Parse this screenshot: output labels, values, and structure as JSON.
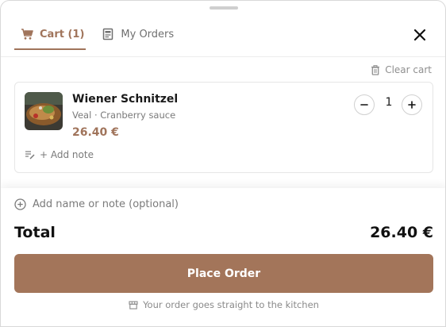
{
  "tabs": [
    {
      "label": "Cart (1)",
      "icon": "cart-icon",
      "active": true
    },
    {
      "label": "My Orders",
      "icon": "receipt-icon",
      "active": false
    }
  ],
  "close_icon": "close-icon",
  "clear_cart_label": "Clear cart",
  "cart_items": [
    {
      "name": "Wiener Schnitzel",
      "description": "Veal · Cranberry sauce",
      "price": "26.40 €",
      "quantity": "1",
      "add_note_label": "+ Add note",
      "image": "schnitzel-photo"
    }
  ],
  "footer": {
    "order_note_placeholder": "Add name or note (optional)",
    "total_label": "Total",
    "total_value": "26.40 €",
    "place_order_label": "Place Order",
    "kitchen_note": "Your order goes straight to the kitchen"
  },
  "colors": {
    "accent": "#a3755a",
    "text_primary": "#111111",
    "text_muted": "#7a7a7a"
  }
}
